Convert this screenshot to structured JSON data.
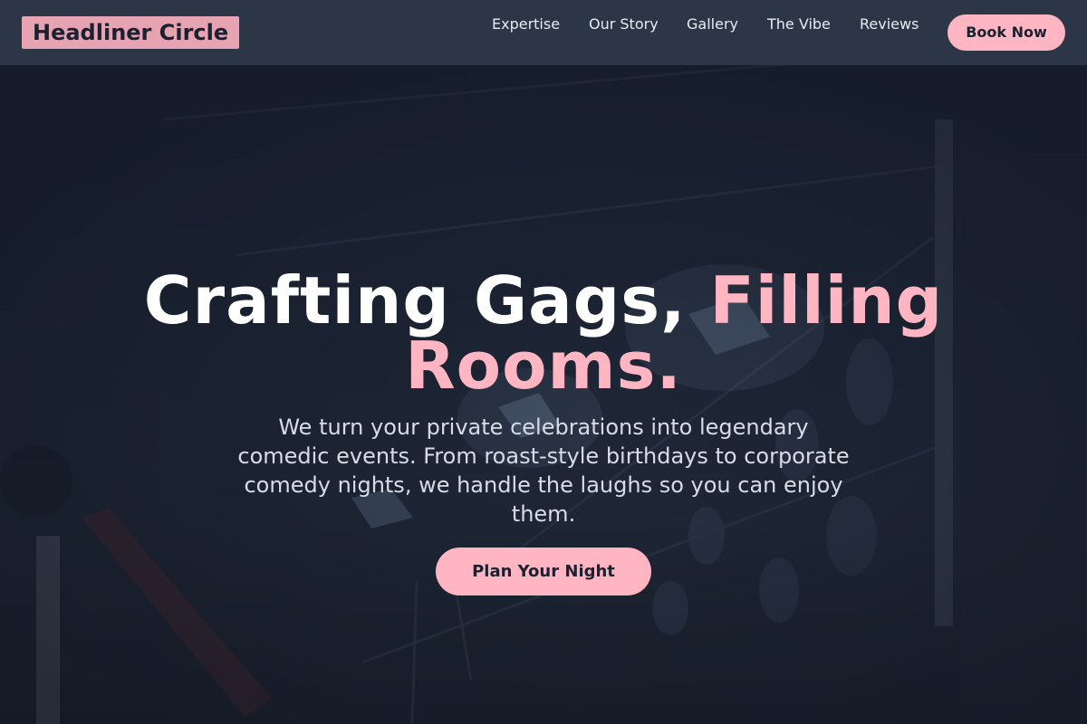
{
  "brand": {
    "name": "Headliner Circle"
  },
  "nav": {
    "items": [
      {
        "label": "Expertise"
      },
      {
        "label": "Our Story"
      },
      {
        "label": "Gallery"
      },
      {
        "label": "The Vibe"
      },
      {
        "label": "Reviews"
      }
    ],
    "cta_label": "Book Now"
  },
  "hero": {
    "title_part1": "Crafting Gags,",
    "title_part2": "Filling",
    "title_part3": "Rooms.",
    "subtitle": "We turn your private celebrations into legendary comedic events. From roast-style birthdays to corporate comedy nights, we handle the laughs so you can enjoy them.",
    "cta_label": "Plan Your Night",
    "background_image": "stage-lighting-rig-photo"
  },
  "colors": {
    "accent": "#ffb5c2",
    "logo_bg": "#e6a3b1",
    "header_bg": "#2d3647",
    "hero_bg": "#1c2434",
    "text_dark": "#1b2130"
  }
}
